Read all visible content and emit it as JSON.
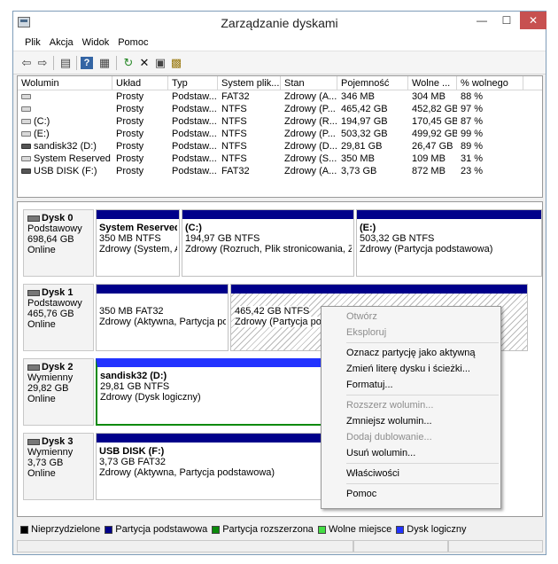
{
  "window": {
    "title": "Zarządzanie dyskami",
    "controls": {
      "minimize": "—",
      "maximize": "☐",
      "close": "✕"
    }
  },
  "menu": [
    "Plik",
    "Akcja",
    "Widok",
    "Pomoc"
  ],
  "toolbar": [
    {
      "icon": "back-arrow-icon",
      "glyph": "⇦"
    },
    {
      "icon": "forward-arrow-icon",
      "glyph": "⇨"
    },
    {
      "icon": "console-tree-icon",
      "glyph": "▤"
    },
    {
      "icon": "help-icon",
      "glyph": "?"
    },
    {
      "icon": "properties-list-icon",
      "glyph": "▦"
    },
    {
      "icon": "refresh-icon",
      "glyph": "↻"
    },
    {
      "icon": "delete-icon",
      "glyph": "✕"
    },
    {
      "icon": "properties-icon",
      "glyph": "▣"
    },
    {
      "icon": "new-volume-icon",
      "glyph": "▩"
    }
  ],
  "volume_list": {
    "columns": [
      "Wolumin",
      "Układ",
      "Typ",
      "System plik...",
      "Stan",
      "Pojemność",
      "Wolne ...",
      "% wolnego"
    ],
    "rows": [
      {
        "name": "",
        "layout": "Prosty",
        "type": "Podstaw...",
        "fs": "FAT32",
        "status": "Zdrowy (A...",
        "capacity": "346 MB",
        "free": "304 MB",
        "pct": "88 %"
      },
      {
        "name": "",
        "layout": "Prosty",
        "type": "Podstaw...",
        "fs": "NTFS",
        "status": "Zdrowy (P...",
        "capacity": "465,42 GB",
        "free": "452,82 GB",
        "pct": "97 %"
      },
      {
        "name": "(C:)",
        "layout": "Prosty",
        "type": "Podstaw...",
        "fs": "NTFS",
        "status": "Zdrowy (R...",
        "capacity": "194,97 GB",
        "free": "170,45 GB",
        "pct": "87 %"
      },
      {
        "name": "(E:)",
        "layout": "Prosty",
        "type": "Podstaw...",
        "fs": "NTFS",
        "status": "Zdrowy (P...",
        "capacity": "503,32 GB",
        "free": "499,92 GB",
        "pct": "99 %"
      },
      {
        "name": "sandisk32 (D:)",
        "layout": "Prosty",
        "type": "Podstaw...",
        "fs": "NTFS",
        "status": "Zdrowy (D...",
        "capacity": "29,81 GB",
        "free": "26,47 GB",
        "pct": "89 %"
      },
      {
        "name": "System Reserved",
        "layout": "Prosty",
        "type": "Podstaw...",
        "fs": "NTFS",
        "status": "Zdrowy (S...",
        "capacity": "350 MB",
        "free": "109 MB",
        "pct": "31 %"
      },
      {
        "name": "USB DISK (F:)",
        "layout": "Prosty",
        "type": "Podstaw...",
        "fs": "FAT32",
        "status": "Zdrowy (A...",
        "capacity": "3,73 GB",
        "free": "872 MB",
        "pct": "23 %"
      }
    ]
  },
  "disks": [
    {
      "name": "Dysk 0",
      "type": "Podstawowy",
      "size": "698,64 GB",
      "state": "Online",
      "partitions": [
        {
          "label": "System Reserved",
          "size_fs": "350 MB NTFS",
          "status": "Zdrowy (System, A"
        },
        {
          "label": "(C:)",
          "size_fs": "194,97 GB NTFS",
          "status": "Zdrowy (Rozruch, Plik stronicowania, Zrzu"
        },
        {
          "label": "(E:)",
          "size_fs": "503,32 GB NTFS",
          "status": "Zdrowy (Partycja podstawowa)"
        }
      ]
    },
    {
      "name": "Dysk 1",
      "type": "Podstawowy",
      "size": "465,76 GB",
      "state": "Online",
      "partitions": [
        {
          "label": "",
          "size_fs": "350 MB FAT32",
          "status": "Zdrowy (Aktywna, Partycja pod"
        },
        {
          "label": "",
          "size_fs": "465,42 GB NTFS",
          "status": "Zdrowy (Partycja podst"
        }
      ]
    },
    {
      "name": "Dysk 2",
      "type": "Wymienny",
      "size": "29,82 GB",
      "state": "Online",
      "partitions": [
        {
          "label": "sandisk32  (D:)",
          "size_fs": "29,81 GB NTFS",
          "status": "Zdrowy (Dysk logiczny)"
        }
      ]
    },
    {
      "name": "Dysk 3",
      "type": "Wymienny",
      "size": "3,73 GB",
      "state": "Online",
      "partitions": [
        {
          "label": "USB DISK  (F:)",
          "size_fs": "3,73 GB FAT32",
          "status": "Zdrowy (Aktywna, Partycja podstawowa)"
        }
      ]
    }
  ],
  "legend": [
    {
      "label": "Nieprzydzielone",
      "color": "#000000"
    },
    {
      "label": "Partycja podstawowa",
      "color": "#00008a"
    },
    {
      "label": "Partycja rozszerzona",
      "color": "#0a8a0a"
    },
    {
      "label": "Wolne miejsce",
      "color": "#44dd44"
    },
    {
      "label": "Dysk logiczny",
      "color": "#2233ff"
    }
  ],
  "context_menu": [
    {
      "label": "Otwórz",
      "enabled": false
    },
    {
      "label": "Eksploruj",
      "enabled": false
    },
    {
      "sep": true
    },
    {
      "label": "Oznacz partycję jako aktywną",
      "enabled": true
    },
    {
      "label": "Zmień literę dysku i ścieżki...",
      "enabled": true
    },
    {
      "label": "Formatuj...",
      "enabled": true
    },
    {
      "sep": true
    },
    {
      "label": "Rozszerz wolumin...",
      "enabled": false
    },
    {
      "label": "Zmniejsz wolumin...",
      "enabled": true
    },
    {
      "label": "Dodaj dublowanie...",
      "enabled": false
    },
    {
      "label": "Usuń wolumin...",
      "enabled": true
    },
    {
      "sep": true
    },
    {
      "label": "Właściwości",
      "enabled": true
    },
    {
      "sep": true
    },
    {
      "label": "Pomoc",
      "enabled": true
    }
  ]
}
